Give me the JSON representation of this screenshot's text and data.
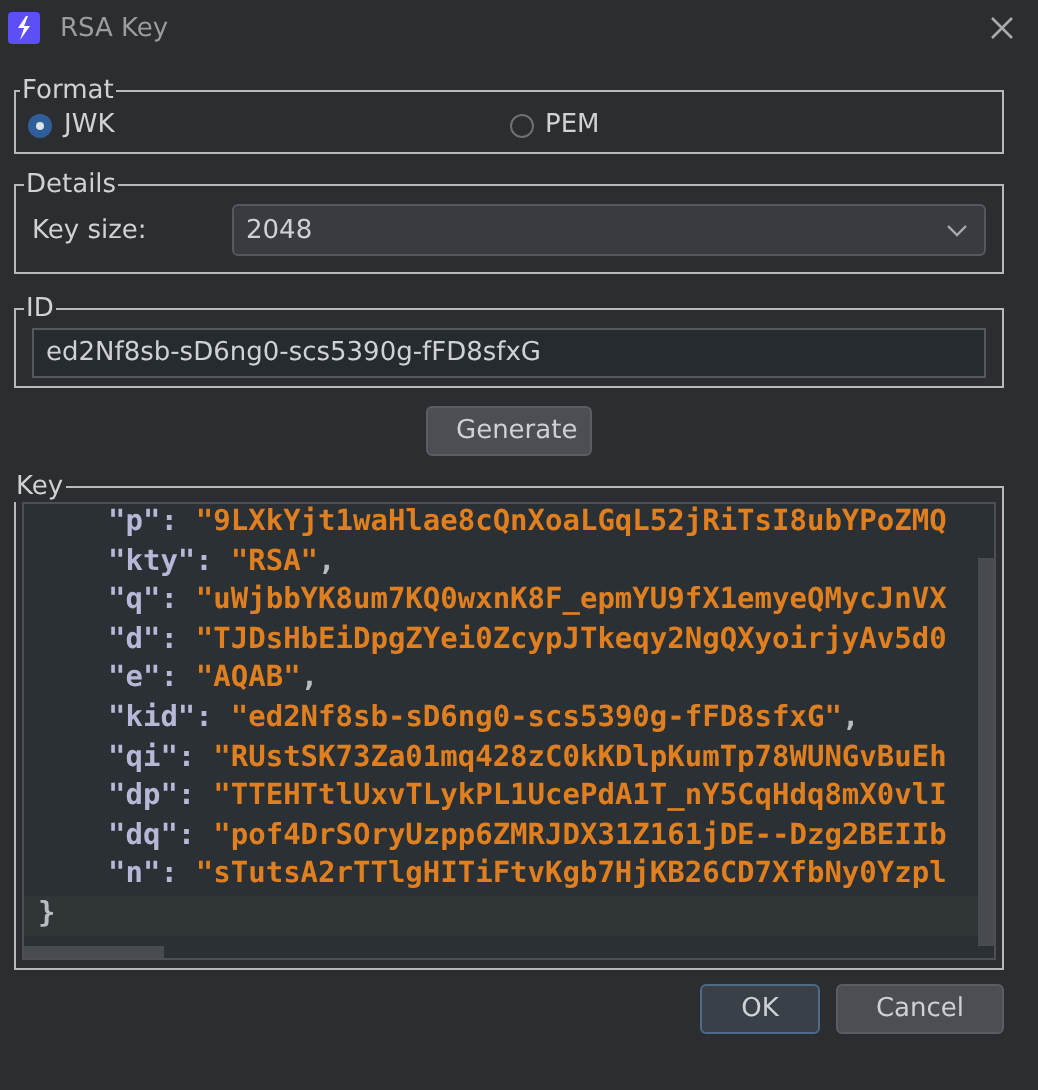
{
  "window": {
    "title": "RSA Key"
  },
  "format": {
    "legend": "Format",
    "options": [
      {
        "label": "JWK",
        "selected": true
      },
      {
        "label": "PEM",
        "selected": false
      }
    ]
  },
  "details": {
    "legend": "Details",
    "key_size": {
      "label": "Key size:",
      "value": "2048"
    }
  },
  "id": {
    "legend": "ID",
    "value": "ed2Nf8sb-sD6ng0-scs5390g-fFD8sfxG"
  },
  "generate_button": "Generate",
  "key": {
    "legend": "Key",
    "lines": [
      {
        "key": "\"p\":",
        "value": "\"9LXkYjt1waHlae8cQnXoaLGqL52jRiTsI8ubYPoZMQ"
      },
      {
        "key": "\"kty\":",
        "value": "\"RSA\"",
        "comma": ","
      },
      {
        "key": "\"q\":",
        "value": "\"uWjbbYK8um7KQ0wxnK8F_epmYU9fX1emyeQMycJnVX"
      },
      {
        "key": "\"d\":",
        "value": "\"TJDsHbEiDpgZYei0ZcypJTkeqy2NgQXyoirjyAv5d0"
      },
      {
        "key": "\"e\":",
        "value": "\"AQAB\"",
        "comma": ","
      },
      {
        "key": "\"kid\":",
        "value": "\"ed2Nf8sb-sD6ng0-scs5390g-fFD8sfxG\"",
        "comma": ","
      },
      {
        "key": "\"qi\":",
        "value": "\"RUstSK73Za01mq428zC0kKDlpKumTp78WUNGvBuEh"
      },
      {
        "key": "\"dp\":",
        "value": "\"TTEHTtlUxvTLykPL1UcePdA1T_nY5CqHdq8mX0vlI"
      },
      {
        "key": "\"dq\":",
        "value": "\"pof4DrSOryUzpp6ZMRJDX31Z161jDE--Dzg2BEIIb"
      },
      {
        "key": "\"n\":",
        "value": "\"sTutsA2rTTlgHITiFtvKgb7HjKB26CD7XfbNy0Yzpl"
      }
    ],
    "closing": "}"
  },
  "buttons": [
    {
      "label": "OK",
      "default": true
    },
    {
      "label": "Cancel",
      "default": false
    }
  ]
}
